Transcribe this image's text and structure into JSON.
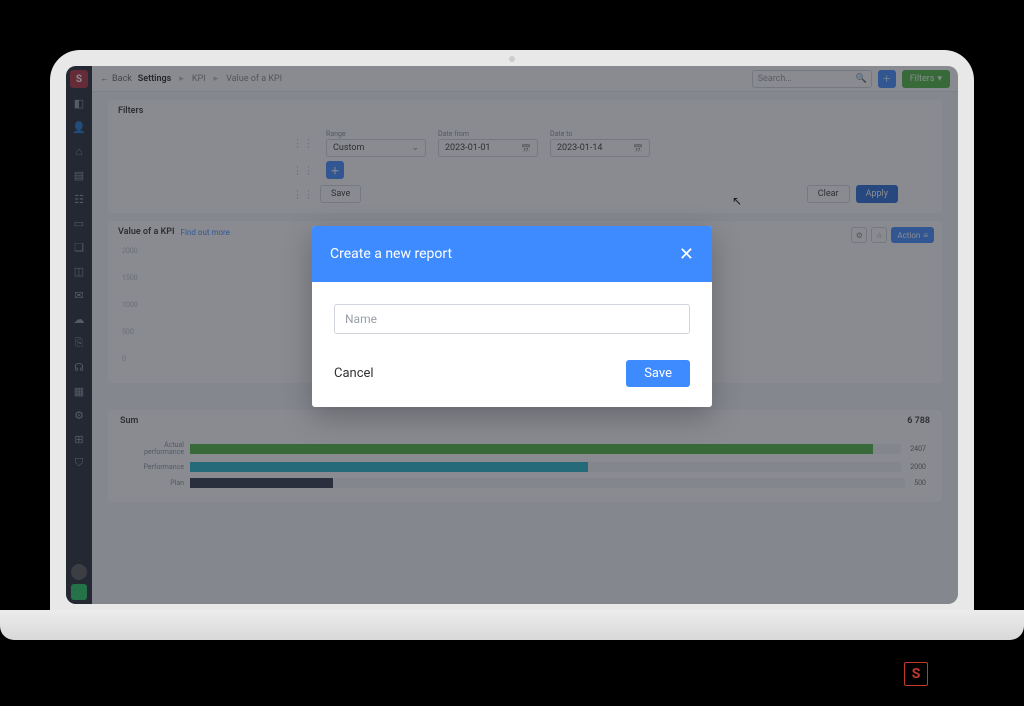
{
  "header": {
    "back_label": "Back",
    "crumb1": "Settings",
    "crumb2": "KPI",
    "crumb3": "Value of a KPI",
    "search_placeholder": "Search…",
    "filters_btn": "Filters"
  },
  "filters_card": {
    "title": "Filters",
    "range_label": "Range",
    "range_value": "Custom",
    "date_from_label": "Date from",
    "date_from_value": "2023-01-01",
    "date_to_label": "Date to",
    "date_to_value": "2023-01-14",
    "save_btn": "Save",
    "clear_btn": "Clear",
    "apply_btn": "Apply"
  },
  "kpi_card": {
    "title": "Value of a KPI",
    "find_link": "Find out more",
    "actions_btn": "Action",
    "y_ticks": [
      "2000",
      "1500",
      "1000",
      "500",
      "0"
    ]
  },
  "legend": {
    "actual": "Actual performance",
    "performance": "Performance",
    "plan": "Plan"
  },
  "sum_card": {
    "title": "Sum",
    "total": "6 788",
    "bars": {
      "actual_label": "Actual performance",
      "actual_value": "2407",
      "performance_label": "Performance",
      "performance_value": "2000",
      "plan_label": "Plan",
      "plan_value": "500"
    }
  },
  "modal": {
    "title": "Create a new report",
    "name_placeholder": "Name",
    "cancel": "Cancel",
    "save": "Save"
  },
  "colors": {
    "primary": "#3e8bff",
    "green": "#49b53a",
    "teal": "#20b7c9",
    "dark": "#2b3443"
  },
  "chart_data": {
    "type": "bar",
    "title": "Sum",
    "categories": [
      "Actual performance",
      "Performance",
      "Plan"
    ],
    "series": [
      {
        "name": "Actual performance",
        "values": [
          2407
        ],
        "color": "#49b53a"
      },
      {
        "name": "Performance",
        "values": [
          2000
        ],
        "color": "#20b7c9"
      },
      {
        "name": "Plan",
        "values": [
          500
        ],
        "color": "#2b3443"
      }
    ],
    "total": 6788,
    "ylabel": "",
    "xlabel": "",
    "ylim": [
      0,
      2500
    ]
  }
}
